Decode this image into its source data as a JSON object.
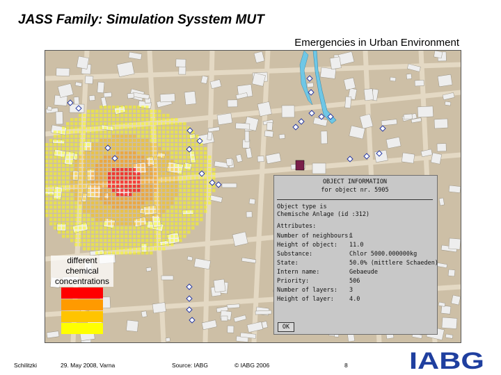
{
  "slide": {
    "title": "JASS Family: Simulation Sysstem MUT",
    "subtitle": "Emergencies in Urban Environment"
  },
  "legend": {
    "label_lines": [
      "different",
      "chemical",
      "concentrations"
    ],
    "colors": [
      "#ff0000",
      "#ff9a00",
      "#ffc400",
      "#ffff00"
    ]
  },
  "popup": {
    "header_line1": "OBJECT INFORMATION",
    "header_line2": "for object nr. 5905",
    "object_type_line1": "Object type is",
    "object_type_line2": "Chemische Anlage (id :312)",
    "attributes_heading": "Attributes:",
    "attributes": [
      {
        "key": "Number of neighbours:",
        "value": "1"
      },
      {
        "key": "Height of object:",
        "value": "11.0"
      },
      {
        "key": "Substance:",
        "value": "Chlor 5000.000000kg"
      },
      {
        "key": "State:",
        "value": "50.0% (mittlere Schaeden)"
      },
      {
        "key": "Intern name:",
        "value": "Gebaeude"
      },
      {
        "key": "Priority:",
        "value": "506"
      },
      {
        "key": "Number of layers:",
        "value": "3"
      },
      {
        "key": "Height of layer:",
        "value": "4.0"
      }
    ],
    "ok_label": "OK"
  },
  "footer": {
    "author": "Schilitzki",
    "date": "29. May 2008, Varna",
    "source": "Source: IABG",
    "copyright": "© IABG 2006",
    "page": "8"
  },
  "logo": {
    "text": "IABG",
    "color": "#1f3f9f"
  },
  "map": {
    "base_color": "#cdbfa6",
    "building_color": "#eeeeee",
    "river_color": "#6fc7e6"
  }
}
